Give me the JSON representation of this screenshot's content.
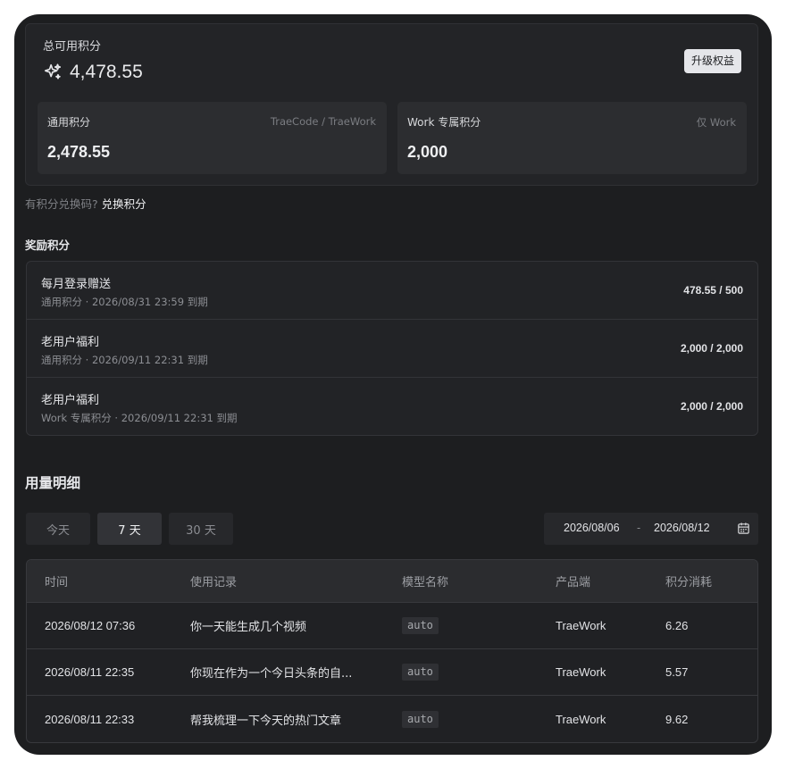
{
  "summary": {
    "label": "总可用积分",
    "total": "4,478.55",
    "upgrade_label": "升级权益",
    "general": {
      "title": "通用积分",
      "note": "TraeCode / TraeWork",
      "value": "2,478.55"
    },
    "work": {
      "title": "Work 专属积分",
      "note": "仅 Work",
      "value": "2,000"
    }
  },
  "redeem": {
    "prompt": "有积分兑换码?",
    "link": "兑换积分"
  },
  "rewards": {
    "title": "奖励积分",
    "items": [
      {
        "name": "每月登录赠送",
        "meta": "通用积分 · 2026/08/31 23:59 到期",
        "amount": "478.55 / 500"
      },
      {
        "name": "老用户福利",
        "meta": "通用积分 · 2026/09/11 22:31 到期",
        "amount": "2,000 / 2,000"
      },
      {
        "name": "老用户福利",
        "meta": "Work 专属积分 · 2026/09/11 22:31 到期",
        "amount": "2,000 / 2,000"
      }
    ]
  },
  "usage": {
    "title": "用量明细",
    "tabs": [
      {
        "label": "今天",
        "active": false
      },
      {
        "label": "7 天",
        "active": true
      },
      {
        "label": "30 天",
        "active": false
      }
    ],
    "date_range": {
      "start": "2026/08/06",
      "separator": "-",
      "end": "2026/08/12"
    },
    "columns": [
      "时间",
      "使用记录",
      "模型名称",
      "产品端",
      "积分消耗"
    ],
    "rows": [
      {
        "time": "2026/08/12 07:36",
        "record": "你一天能生成几个视频",
        "model": "auto",
        "product": "TraeWork",
        "cost": "6.26"
      },
      {
        "time": "2026/08/11 22:35",
        "record": "你现在作为一个今日头条的自...",
        "model": "auto",
        "product": "TraeWork",
        "cost": "5.57"
      },
      {
        "time": "2026/08/11 22:33",
        "record": "帮我梳理一下今天的热门文章",
        "model": "auto",
        "product": "TraeWork",
        "cost": "9.62"
      }
    ]
  },
  "icons": {
    "sparkle": "sparkle-icon",
    "calendar": "calendar-icon"
  },
  "colors": {
    "panel": "#1d1e20",
    "card": "#232427",
    "accent_button": "#e5e6ea",
    "muted_text": "#7e8085"
  }
}
